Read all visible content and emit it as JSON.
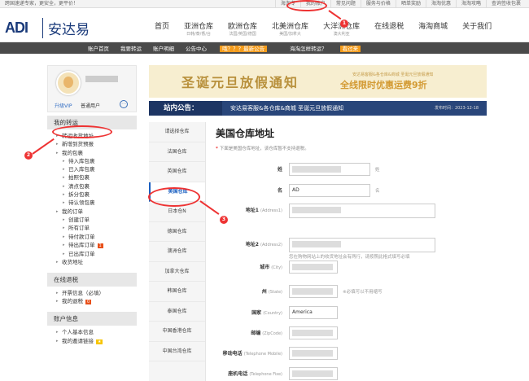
{
  "topbar": {
    "welcome": "跨国速递专家，更安全，更平价！",
    "links": [
      "海淘专",
      "我的账户",
      "常见问题",
      "服务与价格",
      "晒单奖励",
      "海淘优惠",
      "海淘攻略",
      "查询签收包裹"
    ]
  },
  "brand": {
    "logo": "ADI",
    "name": "安达易"
  },
  "nav": [
    {
      "label": "首页",
      "sub": ""
    },
    {
      "label": "亚洲仓库",
      "sub": "日韩/泰/香/台"
    },
    {
      "label": "欧洲仓库",
      "sub": "法国/英国/德国"
    },
    {
      "label": "北美洲仓库",
      "sub": "美国/加拿大"
    },
    {
      "label": "大洋洲仓库",
      "sub": "澳大利亚"
    },
    {
      "label": "在线退税",
      "sub": ""
    },
    {
      "label": "海淘商城",
      "sub": ""
    },
    {
      "label": "关于我们",
      "sub": ""
    }
  ],
  "subnav": {
    "items": [
      "账户首页",
      "我要转运",
      "账户明细",
      "公告中心"
    ],
    "promo1": "哦？？？最新公告",
    "faq": "海淘怎样转运？",
    "promo2": "看过来"
  },
  "user": {
    "level": "升级VIP",
    "type": "普通用户"
  },
  "sidebar": {
    "zhuanyun": {
      "title": "我的转运",
      "items": [
        {
          "label": "转运收货地址",
          "sub": false,
          "badge": ""
        },
        {
          "label": "新增到货预报",
          "sub": false,
          "badge": ""
        },
        {
          "label": "我的包裹",
          "sub": false,
          "badge": ""
        },
        {
          "label": "待入库包裹",
          "sub": true,
          "badge": ""
        },
        {
          "label": "已入库包裹",
          "sub": true,
          "badge": ""
        },
        {
          "label": "拍照包裹",
          "sub": true,
          "badge": ""
        },
        {
          "label": "清点包裹",
          "sub": true,
          "badge": ""
        },
        {
          "label": "拆分包裹",
          "sub": true,
          "badge": ""
        },
        {
          "label": "待认领包裹",
          "sub": true,
          "badge": ""
        },
        {
          "label": "我的订单",
          "sub": false,
          "badge": ""
        },
        {
          "label": "创建订单",
          "sub": true,
          "badge": ""
        },
        {
          "label": "所有订单",
          "sub": true,
          "badge": ""
        },
        {
          "label": "待付款订单",
          "sub": true,
          "badge": ""
        },
        {
          "label": "待出库订单",
          "sub": true,
          "badge": "1"
        },
        {
          "label": "已出库订单",
          "sub": true,
          "badge": ""
        },
        {
          "label": "收货地址",
          "sub": false,
          "badge": ""
        }
      ]
    },
    "tuishui": {
      "title": "在线退税",
      "items": [
        {
          "label": "开票信息（必填）",
          "badge": ""
        },
        {
          "label": "我的退税",
          "badge": "0"
        }
      ]
    },
    "zhanghu": {
      "title": "账户信息",
      "items": [
        {
          "label": "个人基本信息",
          "badge": ""
        },
        {
          "label": "我的邀请链接",
          "badge": "★"
        }
      ]
    }
  },
  "banner": {
    "title": "圣诞元旦放假通知",
    "small": "安达易客服&各仓库&商城 圣诞元旦放假通知",
    "promo": "全线限时优惠运费9折"
  },
  "notice": {
    "head": "站内公告：",
    "msg": "安达易客服&各仓库&商城 圣诞元旦放假通知",
    "date": "发布时间：2023-12-18"
  },
  "warehouses": {
    "header": "请选择仓库",
    "list": [
      "法国仓库",
      "英国仓库",
      "美国仓库",
      "日本仓N",
      "德国仓库",
      "澳洲仓库",
      "加拿大仓库",
      "韩国仓库",
      "泰国仓库",
      "中国香港仓库",
      "中国台湾仓库"
    ]
  },
  "form": {
    "title": "美国仓库地址",
    "hint": "下面是美国仓库地址，该仓库暂不支持退税。",
    "fields": [
      {
        "label": "姓",
        "en": "",
        "value": "",
        "tip": "姓"
      },
      {
        "label": "名",
        "en": "",
        "value": "AD",
        "tip": "名"
      },
      {
        "label": "地址1",
        "en": "(Address1)",
        "value": "",
        "tip": ""
      },
      {
        "label": "地址2",
        "en": "(Address2)",
        "value": "",
        "tip": "您在购物网站上的收货地址会有两行，请按照此格式填写必填"
      },
      {
        "label": "城市",
        "en": "(City)",
        "value": "",
        "tip": ""
      },
      {
        "label": "州",
        "en": "(State)",
        "value": "",
        "tip": "※必填可以不用缩写"
      },
      {
        "label": "国家",
        "en": "(Country)",
        "value": "America",
        "tip": ""
      },
      {
        "label": "邮编",
        "en": "(ZipCode)",
        "value": "",
        "tip": ""
      },
      {
        "label": "移动电话",
        "en": "(Telephone Mobile)",
        "value": "",
        "tip": ""
      },
      {
        "label": "座机电话",
        "en": "(Telephone Fixe)",
        "value": "",
        "tip": ""
      }
    ]
  },
  "annotations": [
    "1",
    "2",
    "3"
  ]
}
